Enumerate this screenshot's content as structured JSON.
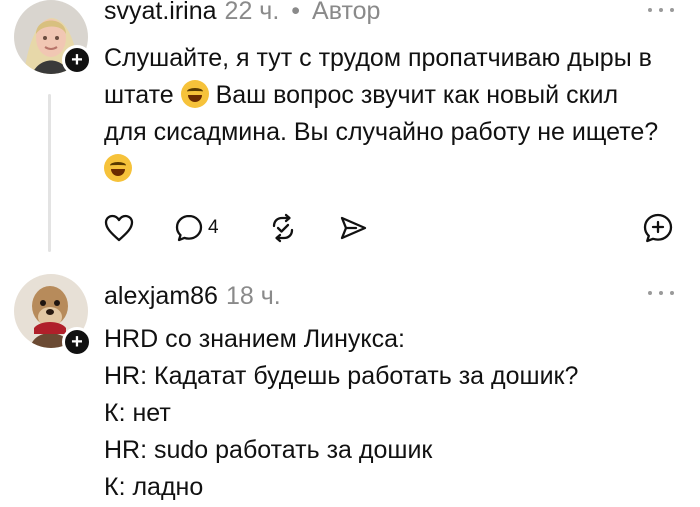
{
  "posts": [
    {
      "username": "svyat.irina",
      "time": "22 ч.",
      "badge": "Автор",
      "lines": [
        "Слушайте, я тут с трудом пропатчиваю дыры в",
        "штате",
        "Ваш вопрос звучит как новый скил",
        "для сисадмина. Вы случайно работу не ищете?"
      ],
      "emoji": "laughing-face",
      "actions": {
        "comments_count": "4"
      }
    },
    {
      "username": "alexjam86",
      "time": "18 ч.",
      "lines": [
        "HRD со знанием Линукса:",
        "HR: Кадатат будешь работать за дошик?",
        "К: нет",
        "HR: sudo работать за дошик",
        "К: ладно"
      ]
    }
  ],
  "icons": [
    "heart-icon",
    "comment-icon",
    "repost-icon",
    "share-icon",
    "quote-add-icon",
    "more-icon",
    "plus-icon"
  ]
}
